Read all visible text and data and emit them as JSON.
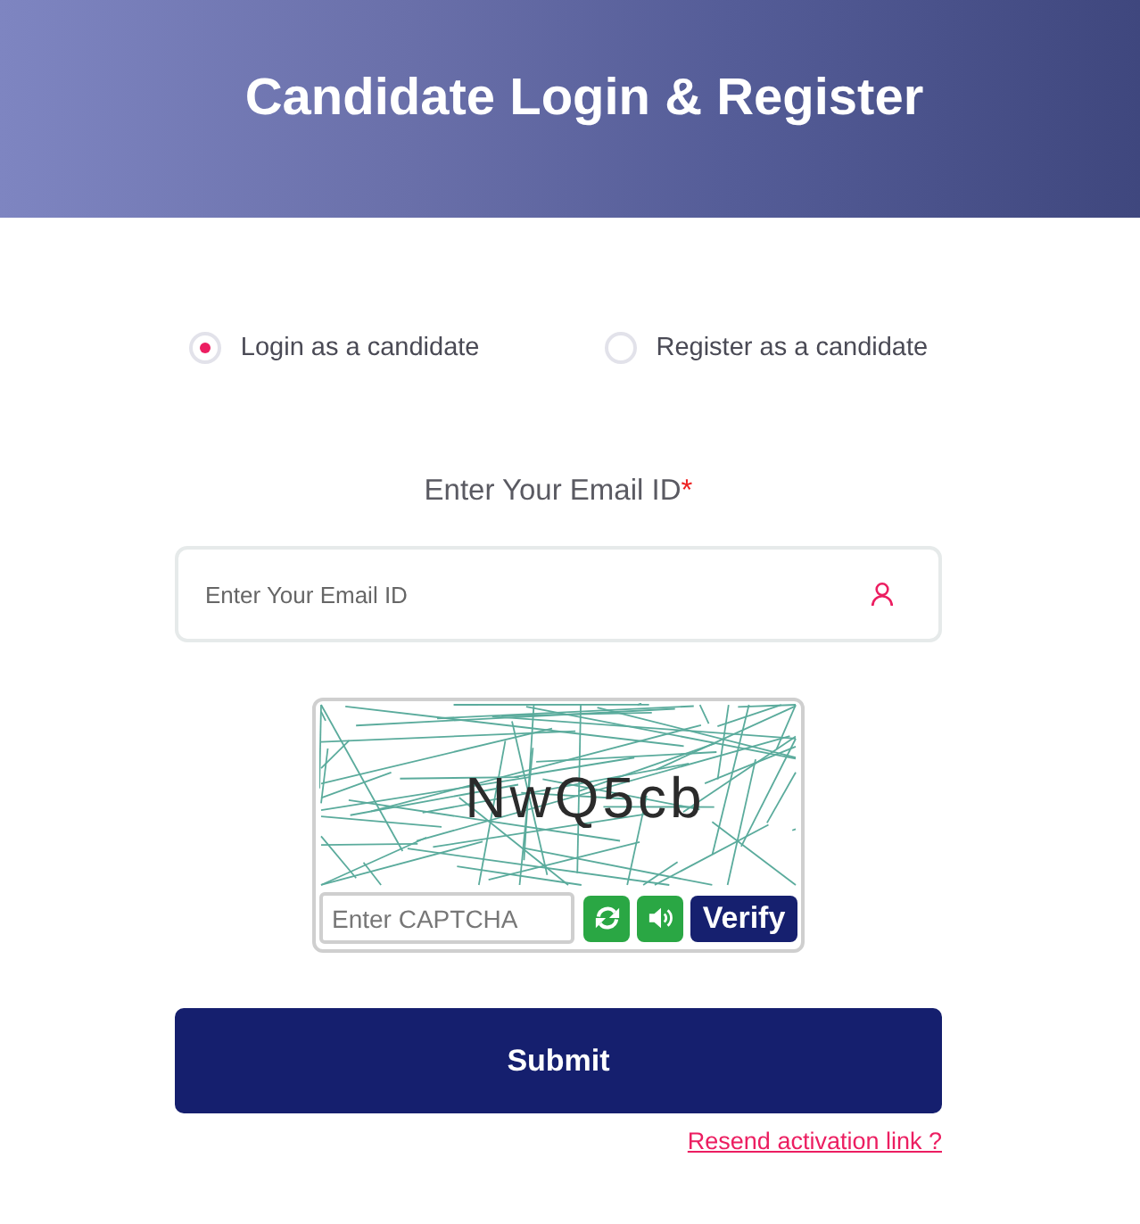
{
  "header": {
    "title": "Candidate Login & Register"
  },
  "login_mode": [
    {
      "label": "Login as a candidate",
      "selected": true
    },
    {
      "label": "Register as a candidate",
      "selected": false
    }
  ],
  "email_field": {
    "label": "Enter Your Email ID",
    "required_mark": "*",
    "placeholder": "Enter Your Email ID"
  },
  "captcha": {
    "code": "NwQ5cb",
    "input_placeholder": "Enter CAPTCHA",
    "verify_button": "Verify"
  },
  "submit_button": "Submit",
  "resend_link": "Resend activation link ?"
}
